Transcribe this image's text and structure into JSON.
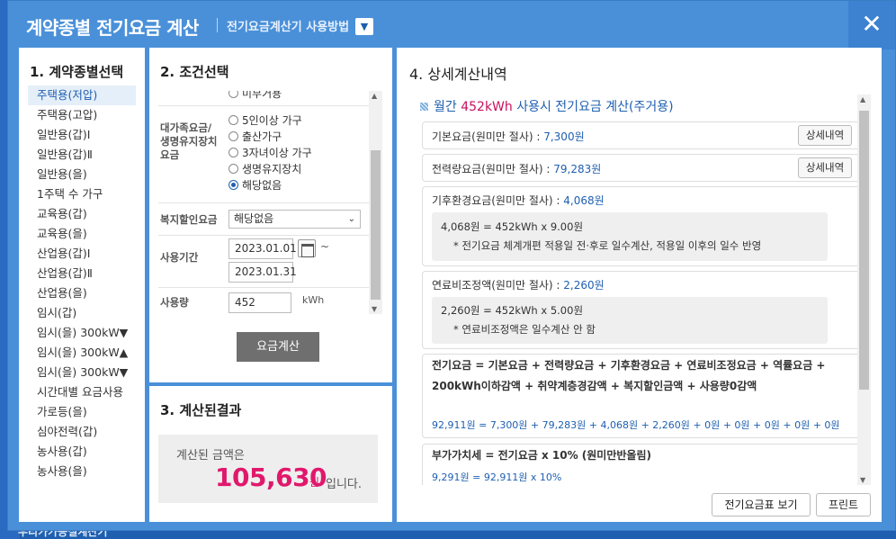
{
  "background": {
    "bottom_text": "우리가가공설계산기"
  },
  "dialog": {
    "title": "계약종별 전기요금 계산",
    "help_link": "전기요금계산기 사용방법",
    "close_glyph": "✕"
  },
  "panel1": {
    "title": "1. 계약종별선택",
    "items": [
      "주택용(저압)",
      "주택용(고압)",
      "일반용(갑)Ⅰ",
      "일반용(갑)Ⅱ",
      "일반용(을)",
      "1주택 수 가구",
      "교육용(갑)",
      "교육용(을)",
      "산업용(갑)Ⅰ",
      "산업용(갑)Ⅱ",
      "산업용(을)",
      "임시(갑)",
      "임시(을) 300kW▼",
      "임시(을) 300kW▲",
      "임시(을) 300kW▼",
      "시간대별 요금사용",
      "가로등(을)",
      "심야전력(갑)",
      "농사용(갑)",
      "농사용(을)"
    ],
    "active_index": 0
  },
  "panel2": {
    "title": "2. 조건선택",
    "partial_radio": "미부거용",
    "discount_label": "대가족요금/\n생명유지장치\n요금",
    "discount_options": [
      "5인이상 가구",
      "출산가구",
      "3자녀이상 가구",
      "생명유지장치",
      "해당없음"
    ],
    "discount_selected": 4,
    "welfare_label": "복지할인요금",
    "welfare_value": "해당없음",
    "period_label": "사용기간",
    "start_date": "2023.01.01",
    "end_date": "2023.01.31",
    "tilde": "~",
    "usage_label": "사용량",
    "usage_value": "452",
    "usage_unit": "kWh",
    "calc_button": "요금계산"
  },
  "panel3": {
    "title": "3. 계산된결과",
    "label": "계산된 금액은",
    "amount": "105,630",
    "won": "원",
    "tail": "입니다."
  },
  "panel4": {
    "title": "4. 상세계산내역",
    "head_prefix": "월간 ",
    "head_usage": "452kWh",
    "head_suffix": " 사용시 전기요금 계산(주거용)",
    "basic_label": "기본요금(원미만 절사) : ",
    "basic_value": "7,300원",
    "energy_label": "전력량요금(원미만 절사) : ",
    "energy_value": "79,283원",
    "detail_button": "상세내역",
    "climate_label": "기후환경요금(원미만 절사) : ",
    "climate_value": "4,068원",
    "climate_formula": "4,068원 = 452kWh x 9.00원",
    "climate_note": "* 전기요금 체계개편 적용일 전·후로 일수계산, 적용일 이후의 일수 반영",
    "fuel_label": "연료비조정액(원미만 절사) : ",
    "fuel_value": "2,260원",
    "fuel_formula": "2,260원 = 452kWh x 5.00원",
    "fuel_note": "* 연료비조정액은 일수계산 안 함",
    "total_formula_title": "전기요금 = 기본요금 + 전력량요금 + 기후환경요금 + 연료비조정요금 + 역률요금 + 200kWh이하감액 + 취약계층경감액 + 복지할인금액 + 사용량0감액",
    "total_formula_values": "92,911원 = 7,300원 + 79,283원 + 4,068원 + 2,260원 + 0원 + 0원 + 0원 + 0원 + 0원",
    "vat_title": "부가가치세 = 전기요금 x 10% (원미만반올림)",
    "vat_values": "9,291원 = 92,911원 x 10%",
    "fee_table_button": "전기요금표 보기",
    "print_button": "프린트"
  },
  "colors": {
    "brand_blue": "#1e5fb0",
    "accent_pink": "#e0186c",
    "dialog_bg": "#4a90d9"
  }
}
